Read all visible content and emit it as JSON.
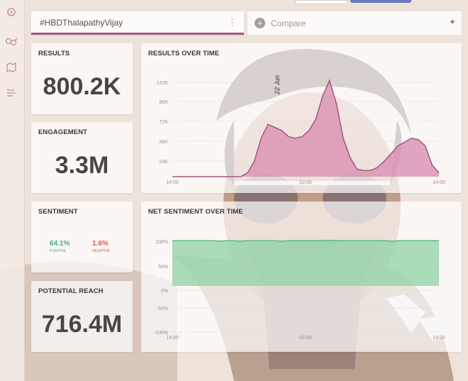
{
  "search": {
    "query": "#HBDThalapathyVijay",
    "menu_icon": "more-vertical-icon"
  },
  "compare": {
    "label": "Compare",
    "icon": "plus-circle-icon",
    "ai_icon": "sparkle-icon"
  },
  "sidebar": {
    "items": [
      {
        "icon": "brain-icon"
      },
      {
        "icon": "gender-icon"
      },
      {
        "icon": "map-icon"
      },
      {
        "icon": "list-icon"
      }
    ]
  },
  "cards": {
    "results": {
      "title": "RESULTS",
      "value": "800.2K"
    },
    "engagement": {
      "title": "ENGAGEMENT",
      "value": "3.3M"
    },
    "sentiment": {
      "title": "SENTIMENT",
      "positive": "64.1%",
      "positive_label": "POSITIVE",
      "negative": "1.6%",
      "negative_label": "NEGATIVE"
    },
    "reach": {
      "title": "POTENTIAL REACH",
      "value": "716.4M"
    }
  },
  "colors": {
    "accent": "#a4577f",
    "area_fill": "#d98ab0",
    "sentiment_fill": "#8fd3a6",
    "positive": "#40b07b",
    "negative": "#e05a55"
  },
  "chart_data": [
    {
      "type": "area",
      "title": "RESULTS OVER TIME",
      "x_ticks": [
        "14:00",
        "02:00",
        "14:00"
      ],
      "y_ticks": [
        "120K",
        "96K",
        "72K",
        "48K",
        "24K"
      ],
      "ylim": [
        0,
        130000
      ],
      "annotation": "22 Jun",
      "series": [
        {
          "values": [
            0,
            0,
            0,
            0,
            0,
            0,
            0,
            0,
            0,
            0,
            0,
            5000,
            20000,
            50000,
            68000,
            64000,
            60000,
            52000,
            50000,
            52000,
            60000,
            75000,
            105000,
            125000,
            95000,
            50000,
            25000,
            10000,
            8000,
            8000,
            12000,
            20000,
            30000,
            40000,
            45000,
            50000,
            48000,
            40000,
            15000,
            5000
          ]
        }
      ]
    },
    {
      "type": "area",
      "title": "NET SENTIMENT OVER TIME",
      "x_ticks": [
        "14:00",
        "02:00",
        "14:00"
      ],
      "y_ticks": [
        "100%",
        "50%",
        "0%",
        "-50%",
        "-100%"
      ],
      "ylim": [
        -100,
        100
      ],
      "series": [
        {
          "values": [
            98,
            98,
            98,
            98,
            98,
            98,
            98,
            97,
            98,
            98,
            97,
            98,
            98,
            98,
            98,
            98,
            97,
            98,
            98,
            98,
            98,
            98,
            98,
            99,
            98,
            98,
            98,
            98,
            98,
            98,
            98,
            98,
            97,
            98,
            98,
            98,
            98,
            98,
            98,
            98
          ]
        }
      ]
    }
  ]
}
